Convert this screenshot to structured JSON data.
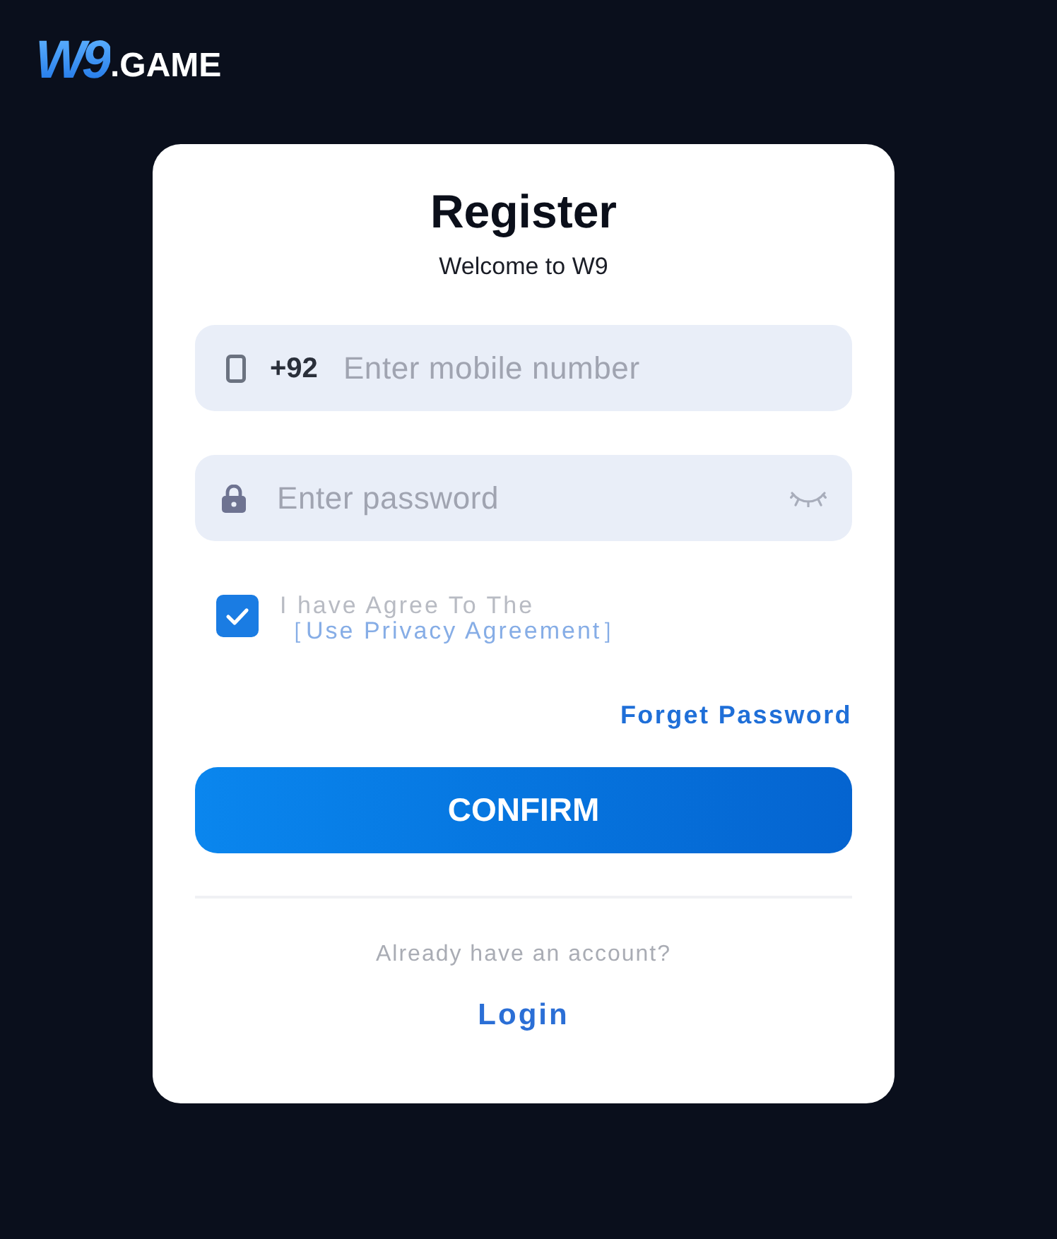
{
  "logo": {
    "mark": "W9",
    "suffix": ".GAME"
  },
  "card": {
    "title": "Register",
    "subtitle": "Welcome to W9"
  },
  "fields": [
    {
      "kind": "phone",
      "prefix": "+92",
      "placeholder": "Enter mobile number"
    },
    {
      "kind": "password",
      "placeholder": "Enter password",
      "password_visible": false
    }
  ],
  "agreement": {
    "checked": true,
    "text": "I have Agree To The",
    "link": "［Use Privacy Agreement］"
  },
  "forgot_link": "Forget Password",
  "confirm_button": "CONFIRM",
  "footer": {
    "prompt": "Already have an account?",
    "link": "Login"
  }
}
